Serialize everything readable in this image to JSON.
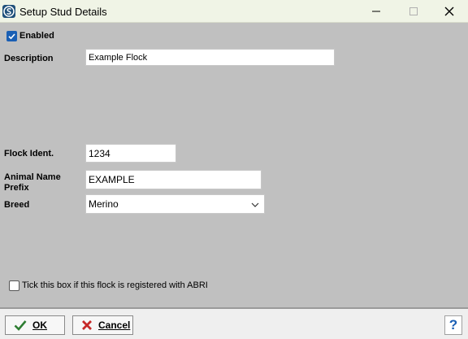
{
  "window": {
    "title": "Setup Stud Details",
    "app_icon": "app-logo-icon",
    "controls": [
      "minimize-icon",
      "maximize-icon",
      "close-icon"
    ]
  },
  "form": {
    "enabled": {
      "label": "Enabled",
      "checked": true
    },
    "description": {
      "label": "Description",
      "value": "Example Flock"
    },
    "flock_ident": {
      "label": "Flock Ident.",
      "value": "1234"
    },
    "animal_name_prefix": {
      "label_line1": "Animal Name",
      "label_line2": "Prefix",
      "value": "EXAMPLE"
    },
    "breed": {
      "label": "Breed",
      "value": "Merino"
    },
    "abri": {
      "label": "Tick this box if this flock is registered with ABRI",
      "checked": false
    }
  },
  "footer": {
    "ok": {
      "label": "OK",
      "icon": "checkmark-icon"
    },
    "cancel": {
      "label": "Cancel",
      "icon": "red-x-icon"
    },
    "help": {
      "label": "?"
    }
  },
  "colors": {
    "accent": "#1a5fb4",
    "body_bg": "#c0c0c0",
    "titlebar_bg": "#f0f4e6",
    "ok_icon": "#2e7d32",
    "cancel_icon": "#c62828"
  }
}
